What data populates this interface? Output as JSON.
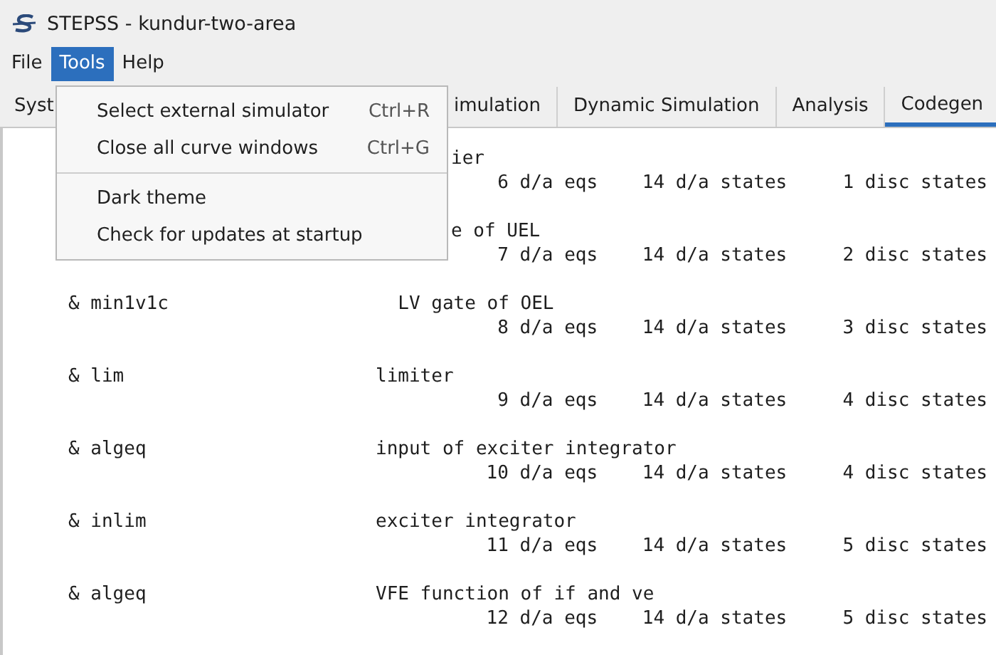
{
  "window": {
    "title": "STEPSS - kundur-two-area"
  },
  "menubar": [
    {
      "label": "File",
      "selected": false
    },
    {
      "label": "Tools",
      "selected": true
    },
    {
      "label": "Help",
      "selected": false
    }
  ],
  "menu": {
    "items": [
      {
        "kind": "action",
        "label": "Select external simulator",
        "shortcut": "Ctrl+R"
      },
      {
        "kind": "action",
        "label": "Close all curve windows",
        "shortcut": "Ctrl+G"
      },
      {
        "kind": "separator"
      },
      {
        "kind": "action",
        "label": "Dark theme"
      },
      {
        "kind": "action",
        "label": "Check for updates at startup"
      }
    ]
  },
  "tabs": [
    {
      "label": "Syst",
      "selected": false
    },
    {
      "label": "imulation",
      "selected": false
    },
    {
      "label": "Dynamic Simulation",
      "selected": false
    },
    {
      "label": "Analysis",
      "selected": false
    },
    {
      "label": "Codegen",
      "selected": true
    }
  ],
  "output": [
    {
      "kind": "covered",
      "description": "ier",
      "counts": "6 d/a eqs    14 d/a states     1 disc states"
    },
    {
      "kind": "covered",
      "description": "e of UEL",
      "counts": "7 d/a eqs    14 d/a states     2 disc states"
    },
    {
      "kind": "full",
      "module": "& min1v1c",
      "description": "  LV gate of OEL",
      "counts": "8 d/a eqs    14 d/a states     3 disc states"
    },
    {
      "kind": "full",
      "module": "& lim",
      "description": "limiter",
      "counts": "9 d/a eqs    14 d/a states     4 disc states"
    },
    {
      "kind": "full",
      "module": "& algeq",
      "description": "input of exciter integrator",
      "counts": "10 d/a eqs    14 d/a states     4 disc states"
    },
    {
      "kind": "full",
      "module": "& inlim",
      "description": "exciter integrator",
      "counts": "11 d/a eqs    14 d/a states     5 disc states"
    },
    {
      "kind": "full",
      "module": "& algeq",
      "description": "VFE function of if and ve",
      "counts": "12 d/a eqs    14 d/a states     5 disc states"
    }
  ]
}
